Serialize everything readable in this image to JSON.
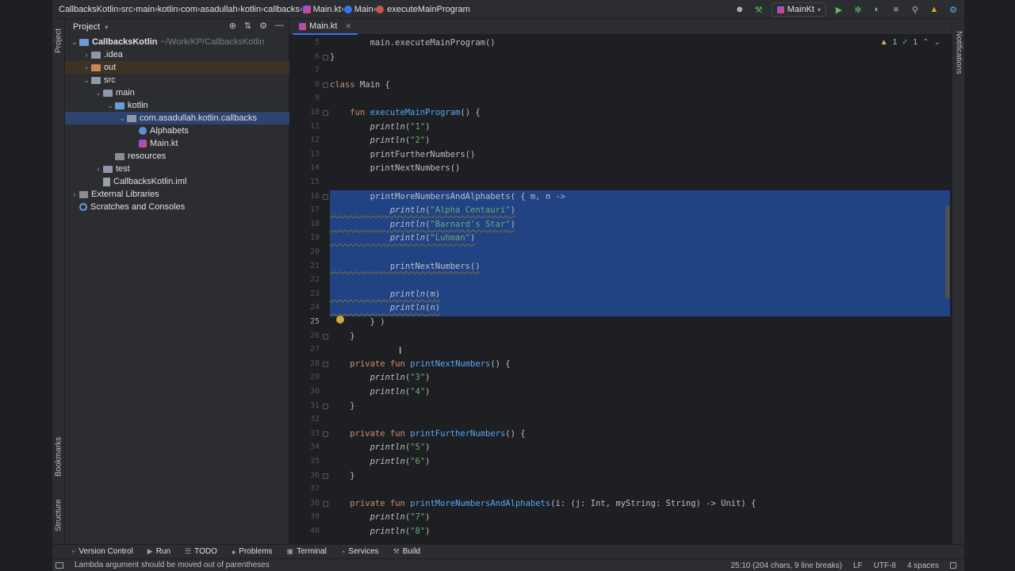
{
  "breadcrumbs": [
    {
      "label": "CallbacksKotlin",
      "icon": "none"
    },
    {
      "label": "src",
      "icon": "none"
    },
    {
      "label": "main",
      "icon": "none"
    },
    {
      "label": "kotlin",
      "icon": "none"
    },
    {
      "label": "com",
      "icon": "none"
    },
    {
      "label": "asadullah",
      "icon": "none"
    },
    {
      "label": "kotlin",
      "icon": "none"
    },
    {
      "label": "callbacks",
      "icon": "none"
    },
    {
      "label": "Main.kt",
      "icon": "kotlin-file-icon"
    },
    {
      "label": "Main",
      "icon": "class-icon"
    },
    {
      "label": "executeMainProgram",
      "icon": "method-icon"
    }
  ],
  "run_config": {
    "label": "MainKt"
  },
  "left_stripe": {
    "project_label": "Project",
    "bookmarks_label": "Bookmarks",
    "structure_label": "Structure"
  },
  "right_stripe": {
    "notifications_label": "Notifications"
  },
  "project_panel": {
    "title": "Project",
    "tree": [
      {
        "label": "CallbacksKotlin",
        "hint": "~/Work/KP/CallbacksKotlin",
        "depth": 0,
        "expanded": "open",
        "kind": "module"
      },
      {
        "label": ".idea",
        "depth": 1,
        "expanded": "closed",
        "kind": "folder"
      },
      {
        "label": "out",
        "depth": 1,
        "expanded": "closed",
        "kind": "folder-orange"
      },
      {
        "label": "src",
        "depth": 1,
        "expanded": "open",
        "kind": "folder"
      },
      {
        "label": "main",
        "depth": 2,
        "expanded": "open",
        "kind": "folder"
      },
      {
        "label": "kotlin",
        "depth": 3,
        "expanded": "open",
        "kind": "folder-blue"
      },
      {
        "label": "com.asadullah.kotlin.callbacks",
        "depth": 4,
        "expanded": "open",
        "kind": "package",
        "selected": true
      },
      {
        "label": "Alphabets",
        "depth": 5,
        "expanded": "none",
        "kind": "class"
      },
      {
        "label": "Main.kt",
        "depth": 5,
        "expanded": "none",
        "kind": "kotlin"
      },
      {
        "label": "resources",
        "depth": 3,
        "expanded": "none",
        "kind": "folder-gray"
      },
      {
        "label": "test",
        "depth": 2,
        "expanded": "closed",
        "kind": "folder"
      },
      {
        "label": "CallbacksKotlin.iml",
        "depth": 2,
        "expanded": "none",
        "kind": "iml"
      },
      {
        "label": "External Libraries",
        "depth": 0,
        "expanded": "closed",
        "kind": "library"
      },
      {
        "label": "Scratches and Consoles",
        "depth": 0,
        "expanded": "none",
        "kind": "scratch"
      }
    ]
  },
  "editor": {
    "tab_label": "Main.kt",
    "inspections": {
      "warnings": "1",
      "ok": "1"
    },
    "current_line": 25,
    "lines": [
      {
        "n": "5",
        "text": "        main.executeMainProgram()"
      },
      {
        "n": "6",
        "text": "}"
      },
      {
        "n": "7",
        "text": ""
      },
      {
        "n": "8",
        "text": "class Main {"
      },
      {
        "n": "9",
        "text": ""
      },
      {
        "n": "10",
        "text": "    fun executeMainProgram() {"
      },
      {
        "n": "11",
        "text": "        println(\"1\")"
      },
      {
        "n": "12",
        "text": "        println(\"2\")"
      },
      {
        "n": "13",
        "text": "        printFurtherNumbers()"
      },
      {
        "n": "14",
        "text": "        printNextNumbers()"
      },
      {
        "n": "15",
        "text": ""
      },
      {
        "n": "16",
        "text": "        printMoreNumbersAndAlphabets( { m, n ->"
      },
      {
        "n": "17",
        "text": "            println(\"Alpha Centauri\")"
      },
      {
        "n": "18",
        "text": "            println(\"Barnard's Star\")"
      },
      {
        "n": "19",
        "text": "            println(\"Luhman\")"
      },
      {
        "n": "20",
        "text": ""
      },
      {
        "n": "21",
        "text": "            printNextNumbers()"
      },
      {
        "n": "22",
        "text": ""
      },
      {
        "n": "23",
        "text": "            println(m)"
      },
      {
        "n": "24",
        "text": "            println(n)"
      },
      {
        "n": "25",
        "text": "        } )"
      },
      {
        "n": "26",
        "text": "    }"
      },
      {
        "n": "27",
        "text": ""
      },
      {
        "n": "28",
        "text": "    private fun printNextNumbers() {"
      },
      {
        "n": "29",
        "text": "        println(\"3\")"
      },
      {
        "n": "30",
        "text": "        println(\"4\")"
      },
      {
        "n": "31",
        "text": "    }"
      },
      {
        "n": "32",
        "text": ""
      },
      {
        "n": "33",
        "text": "    private fun printFurtherNumbers() {"
      },
      {
        "n": "34",
        "text": "        println(\"5\")"
      },
      {
        "n": "35",
        "text": "        println(\"6\")"
      },
      {
        "n": "36",
        "text": "    }"
      },
      {
        "n": "37",
        "text": ""
      },
      {
        "n": "38",
        "text": "    private fun printMoreNumbersAndAlphabets(i: (j: Int, myString: String) -> Unit) {"
      },
      {
        "n": "39",
        "text": "        println(\"7\")"
      },
      {
        "n": "40",
        "text": "        println(\"8\")"
      }
    ]
  },
  "tool_windows": [
    {
      "label": "Version Control",
      "icon": "branch-icon"
    },
    {
      "label": "Run",
      "icon": "run-icon"
    },
    {
      "label": "TODO",
      "icon": "list-icon"
    },
    {
      "label": "Problems",
      "icon": "problems-icon"
    },
    {
      "label": "Terminal",
      "icon": "terminal-icon"
    },
    {
      "label": "Services",
      "icon": "services-icon"
    },
    {
      "label": "Build",
      "icon": "hammer-icon"
    }
  ],
  "status": {
    "message": "Lambda argument should be moved out of parentheses",
    "position": "25:10 (204 chars, 9 line breaks)",
    "line_ending": "LF",
    "encoding": "UTF-8",
    "indent": "4 spaces"
  },
  "colors": {
    "editor_bg": "#1e1f22",
    "panel_bg": "#2b2d30",
    "selection": "#214283",
    "keyword": "#cf8e6d",
    "function": "#56a8f5",
    "string": "#6aab73",
    "accent": "#3574f0"
  }
}
